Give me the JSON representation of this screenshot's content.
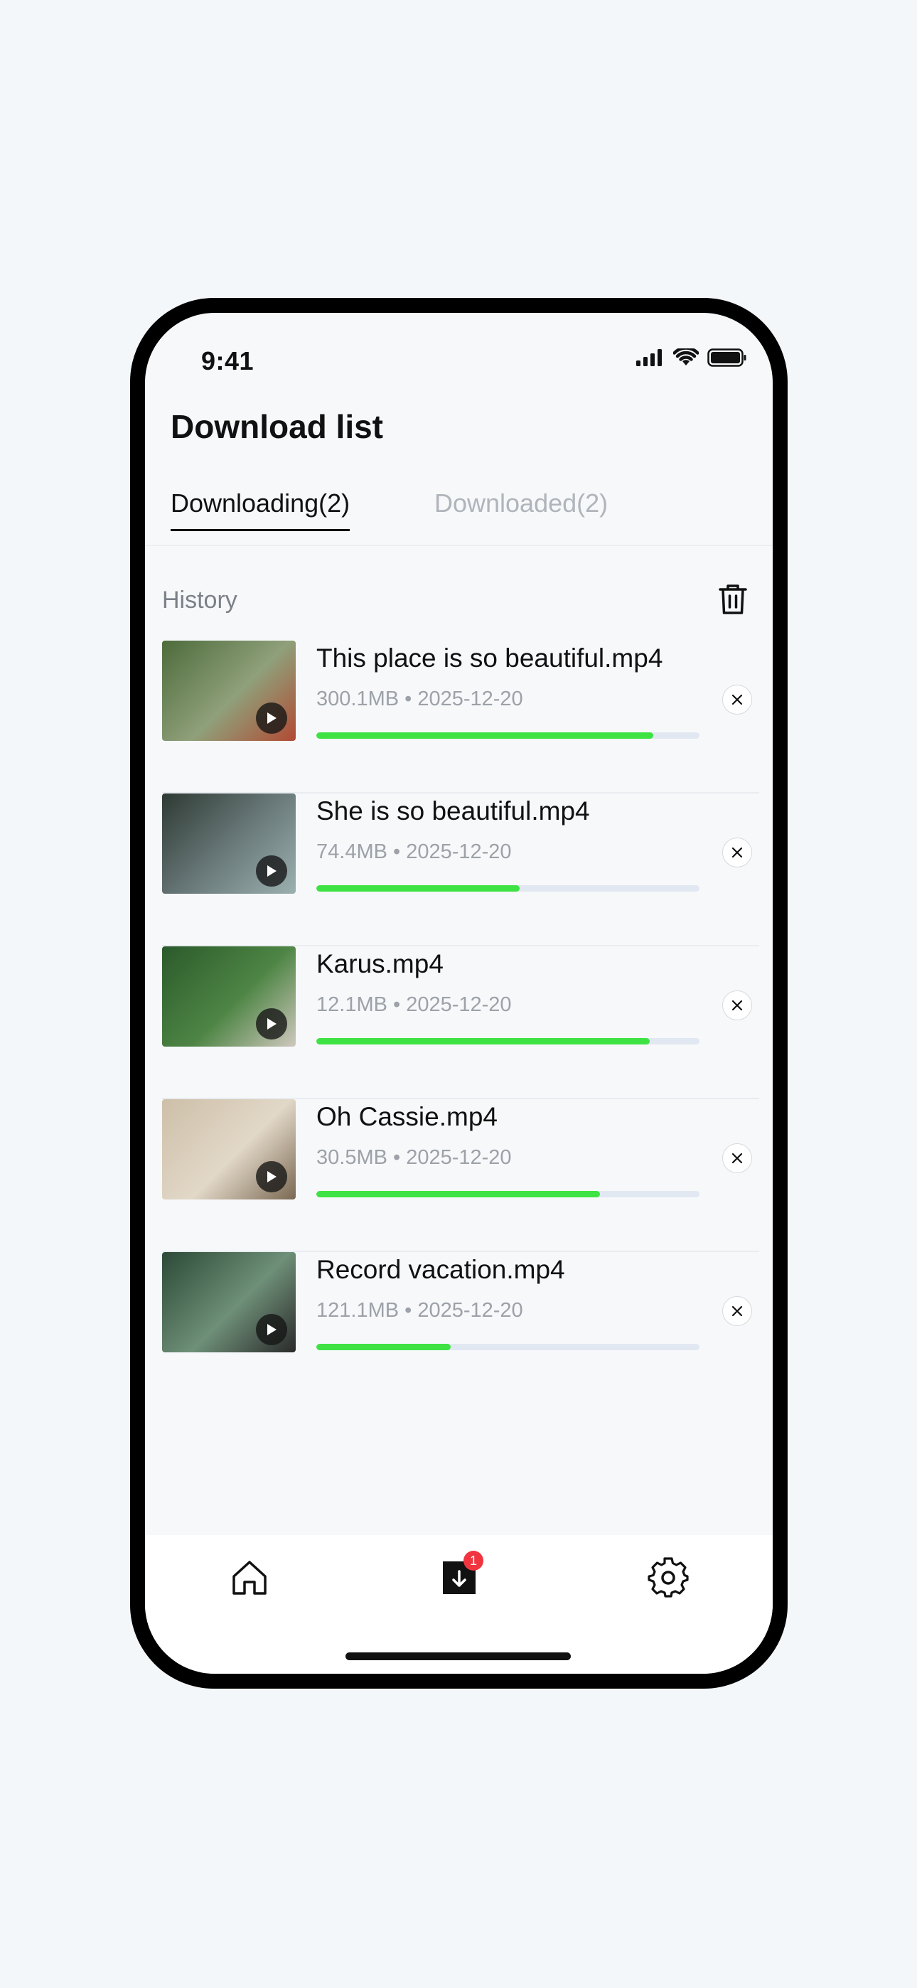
{
  "status_bar": {
    "time": "9:41"
  },
  "header": {
    "title": "Download list"
  },
  "tabs": [
    {
      "label": "Downloading(2)",
      "active": true
    },
    {
      "label": "Downloaded(2)",
      "active": false
    }
  ],
  "section": {
    "label": "History",
    "action_icon": "trash-icon"
  },
  "downloads": [
    {
      "name": "This place is so beautiful.mp4",
      "meta": "300.1MB • 2025-12-20",
      "progress": 0.88,
      "thumb_colors": [
        "#4d6b3b",
        "#8fa07a",
        "#b14a33"
      ]
    },
    {
      "name": "She is so beautiful.mp4",
      "meta": "74.4MB • 2025-12-20",
      "progress": 0.53,
      "thumb_colors": [
        "#2e3a33",
        "#6d7d7e",
        "#9cb0b0"
      ]
    },
    {
      "name": "Karus.mp4",
      "meta": "12.1MB • 2025-12-20",
      "progress": 0.87,
      "thumb_colors": [
        "#2b5a2b",
        "#4e8545",
        "#cfc8bd"
      ]
    },
    {
      "name": "Oh Cassie.mp4",
      "meta": "30.5MB • 2025-12-20",
      "progress": 0.74,
      "thumb_colors": [
        "#cdbfa8",
        "#e2d8c8",
        "#7a6851"
      ]
    },
    {
      "name": "Record vacation.mp4",
      "meta": "121.1MB • 2025-12-20",
      "progress": 0.35,
      "thumb_colors": [
        "#2c4a37",
        "#6e8f78",
        "#2a2a2a"
      ]
    }
  ],
  "bottom_nav": {
    "items": [
      "home-icon",
      "download-icon",
      "settings-icon"
    ],
    "badge": "1"
  },
  "colors": {
    "progress": "#3ee343",
    "track": "#e2e8f2",
    "badge": "#f0353f"
  }
}
